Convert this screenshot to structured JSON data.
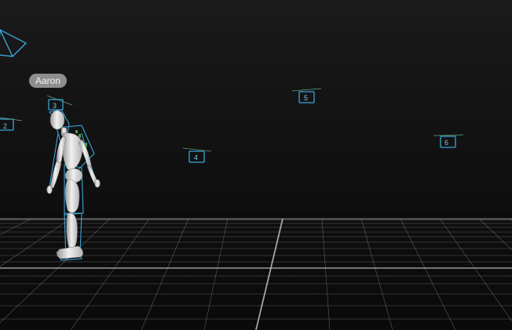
{
  "actor": {
    "name": "Aaron"
  },
  "cameras": [
    {
      "id": "camera-2",
      "number": "2"
    },
    {
      "id": "camera-3",
      "number": "3"
    },
    {
      "id": "camera-4",
      "number": "4"
    },
    {
      "id": "camera-5",
      "number": "5"
    },
    {
      "id": "camera-6",
      "number": "6"
    }
  ],
  "colors": {
    "background": "#0c0c0c",
    "grid": "#bdbdbd",
    "camera_outline": "#3aa6d8",
    "skeleton_outline": "#3aa6d8",
    "mannequin": "#dcdcdc",
    "label_bg": "#8e8e8e"
  }
}
